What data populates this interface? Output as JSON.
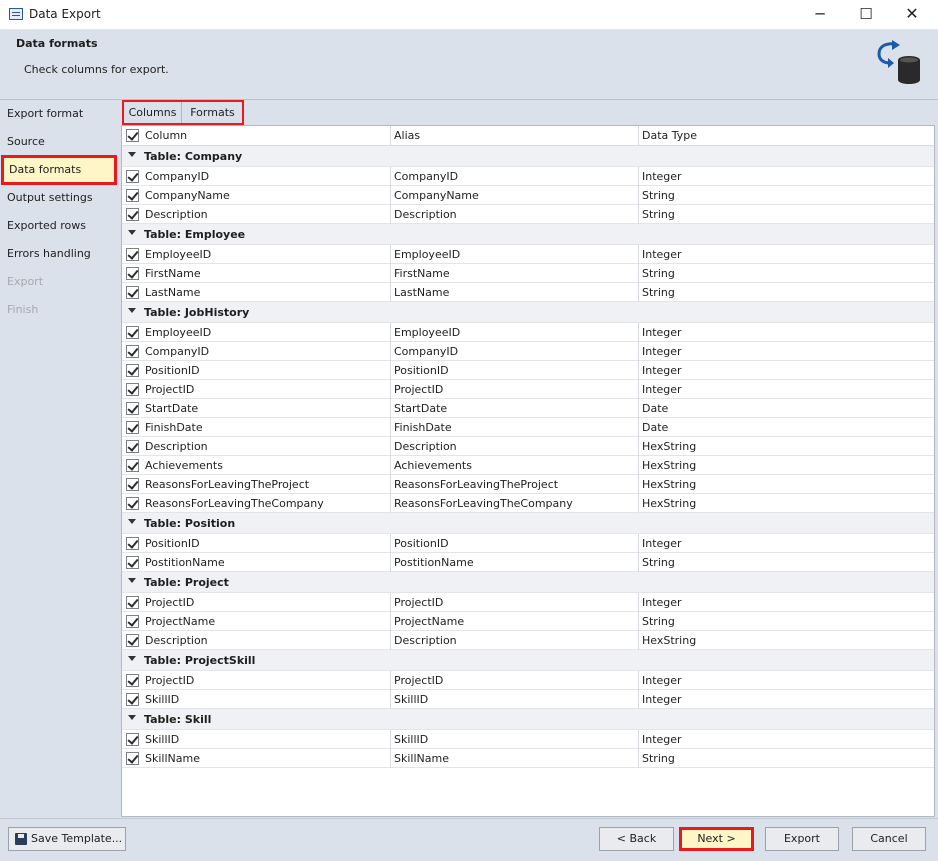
{
  "window": {
    "title": "Data Export",
    "minimize_glyph": "─",
    "maximize_glyph": "☐",
    "close_glyph": "✕",
    "app_icon": "data-export-app-icon"
  },
  "header": {
    "title": "Data formats",
    "subtitle": "Check columns for export.",
    "graphic": "export-database-icon"
  },
  "sidebar": {
    "items": [
      {
        "label": "Export format",
        "state": "normal"
      },
      {
        "label": "Source",
        "state": "normal"
      },
      {
        "label": "Data formats",
        "state": "active"
      },
      {
        "label": "Output settings",
        "state": "normal"
      },
      {
        "label": "Exported rows",
        "state": "normal"
      },
      {
        "label": "Errors handling",
        "state": "normal"
      },
      {
        "label": "Export",
        "state": "disabled"
      },
      {
        "label": "Finish",
        "state": "disabled"
      }
    ]
  },
  "tabs": {
    "columns": "Columns",
    "formats": "Formats"
  },
  "grid": {
    "headers": {
      "column": "Column",
      "alias": "Alias",
      "type": "Data Type"
    },
    "groups": [
      {
        "label": "Table: Company",
        "rows": [
          {
            "column": "CompanyID",
            "alias": "CompanyID",
            "type": "Integer"
          },
          {
            "column": "CompanyName",
            "alias": "CompanyName",
            "type": "String"
          },
          {
            "column": "Description",
            "alias": "Description",
            "type": "String"
          }
        ]
      },
      {
        "label": "Table: Employee",
        "rows": [
          {
            "column": "EmployeeID",
            "alias": "EmployeeID",
            "type": "Integer"
          },
          {
            "column": "FirstName",
            "alias": "FirstName",
            "type": "String"
          },
          {
            "column": "LastName",
            "alias": "LastName",
            "type": "String"
          }
        ]
      },
      {
        "label": "Table: JobHistory",
        "rows": [
          {
            "column": "EmployeeID",
            "alias": "EmployeeID",
            "type": "Integer"
          },
          {
            "column": "CompanyID",
            "alias": "CompanyID",
            "type": "Integer"
          },
          {
            "column": "PositionID",
            "alias": "PositionID",
            "type": "Integer"
          },
          {
            "column": "ProjectID",
            "alias": "ProjectID",
            "type": "Integer"
          },
          {
            "column": "StartDate",
            "alias": "StartDate",
            "type": "Date"
          },
          {
            "column": "FinishDate",
            "alias": "FinishDate",
            "type": "Date"
          },
          {
            "column": "Description",
            "alias": "Description",
            "type": "HexString"
          },
          {
            "column": "Achievements",
            "alias": "Achievements",
            "type": "HexString"
          },
          {
            "column": "ReasonsForLeavingTheProject",
            "alias": "ReasonsForLeavingTheProject",
            "type": "HexString"
          },
          {
            "column": "ReasonsForLeavingTheCompany",
            "alias": "ReasonsForLeavingTheCompany",
            "type": "HexString"
          }
        ]
      },
      {
        "label": "Table: Position",
        "rows": [
          {
            "column": "PositionID",
            "alias": "PositionID",
            "type": "Integer"
          },
          {
            "column": "PostitionName",
            "alias": "PostitionName",
            "type": "String"
          }
        ]
      },
      {
        "label": "Table: Project",
        "rows": [
          {
            "column": "ProjectID",
            "alias": "ProjectID",
            "type": "Integer"
          },
          {
            "column": "ProjectName",
            "alias": "ProjectName",
            "type": "String"
          },
          {
            "column": "Description",
            "alias": "Description",
            "type": "HexString"
          }
        ]
      },
      {
        "label": "Table: ProjectSkill",
        "rows": [
          {
            "column": "ProjectID",
            "alias": "ProjectID",
            "type": "Integer"
          },
          {
            "column": "SkillID",
            "alias": "SkillID",
            "type": "Integer"
          }
        ]
      },
      {
        "label": "Table: Skill",
        "rows": [
          {
            "column": "SkillID",
            "alias": "SkillID",
            "type": "Integer"
          },
          {
            "column": "SkillName",
            "alias": "SkillName",
            "type": "String"
          }
        ]
      }
    ]
  },
  "footer": {
    "save_template": "Save Template...",
    "back": "< Back",
    "next": "Next >",
    "export": "Export",
    "cancel": "Cancel"
  },
  "colors": {
    "highlight_border": "#e8191f",
    "active_fill": "#fff6c8",
    "panel_bg": "#dbe1ea",
    "brand_blue": "#1a5aa8"
  }
}
